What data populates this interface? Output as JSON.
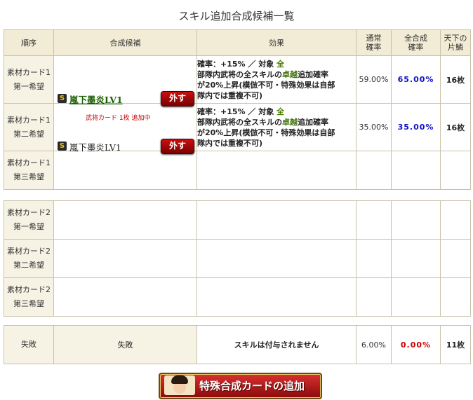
{
  "title": "スキル追加合成候補一覧",
  "headers": {
    "order": "順序",
    "candidate": "合成候補",
    "effect": "効果",
    "normal_rate": [
      "通常",
      "確率"
    ],
    "total_rate": [
      "全合成",
      "確率"
    ],
    "cards": [
      "天下の",
      "片鱗"
    ]
  },
  "rows": [
    {
      "order": [
        "素材カード1",
        "第一希望"
      ],
      "badge": "S",
      "card_name": "嵐下墨炎LV1",
      "remove": "外す",
      "status_note": "武将カード 1枚 追加中",
      "effect": {
        "line1_prefix": "確率：+15% ／ 対象 ",
        "target": "全",
        "line2_a": "部隊内武将の全スキルの",
        "highlight": "卓越",
        "line2_b": "追加確率",
        "line3": "が20%上昇(模倣不可・特殊効果は自部",
        "line4": "隊内では重複不可)"
      },
      "normal_rate": "59.00%",
      "total_rate": "65.00%",
      "cards": "16枚"
    },
    {
      "order": [
        "素材カード1",
        "第二希望"
      ],
      "badge": "S",
      "card_name": "嵐下墨炎LV1",
      "remove": "外す",
      "effect": {
        "line1_prefix": "確率：+15% ／ 対象 ",
        "target": "全",
        "line2_a": "部隊内武将の全スキルの",
        "highlight": "卓越",
        "line2_b": "追加確率",
        "line3": "が20%上昇(模倣不可・特殊効果は自部",
        "line4": "隊内では重複不可)"
      },
      "normal_rate": "35.00%",
      "total_rate": "35.00%",
      "cards": "16枚"
    },
    {
      "order": [
        "素材カード1",
        "第三希望"
      ]
    }
  ],
  "rows2": [
    {
      "order": [
        "素材カード2",
        "第一希望"
      ]
    },
    {
      "order": [
        "素材カード2",
        "第二希望"
      ]
    },
    {
      "order": [
        "素材カード2",
        "第三希望"
      ]
    }
  ],
  "fail_row": {
    "order": "失敗",
    "candidate": "失敗",
    "effect": "スキルは付与されません",
    "normal_rate": "6.00%",
    "total_rate": "0.00%",
    "cards": "11枚"
  },
  "add_button": "特殊合成カードの追加",
  "colors": {
    "total_rate_blue": "#1010c8",
    "total_rate_red": "#cc0000",
    "link_green": "#1a5e00",
    "header_bg": "#f2ecd6"
  }
}
